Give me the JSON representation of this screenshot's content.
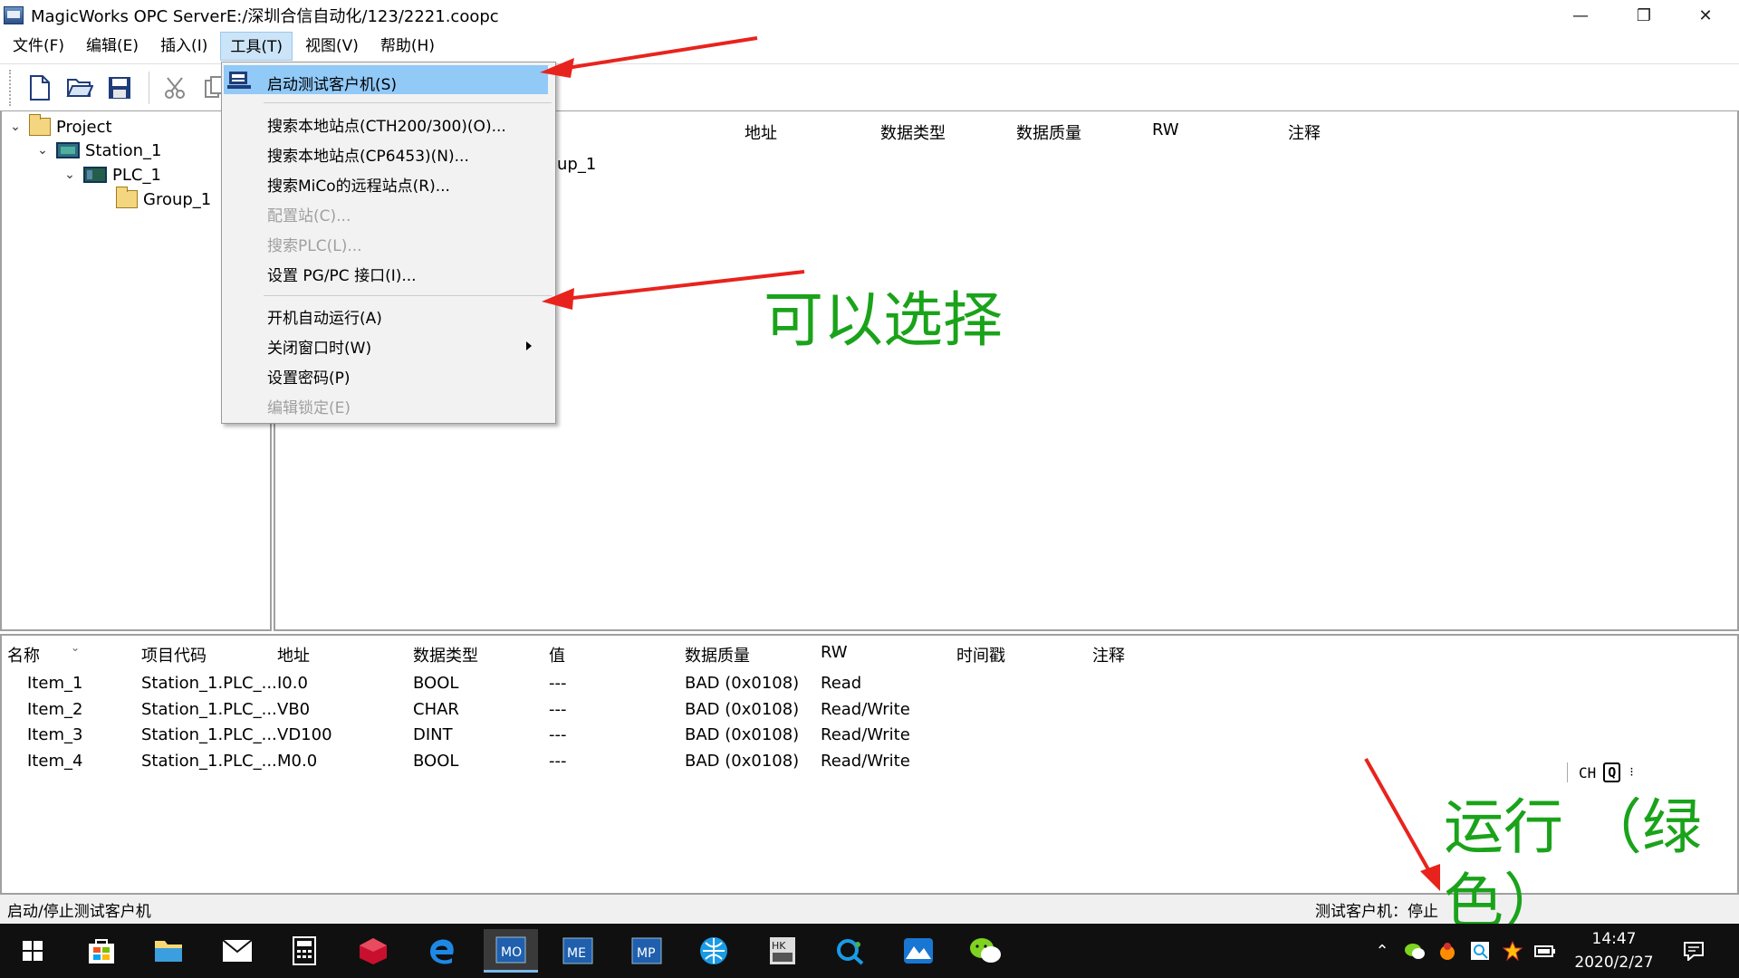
{
  "window": {
    "title": "MagicWorks OPC ServerE:/深圳合信自动化/123/2221.coopc",
    "minimize": "—",
    "maximize": "❐",
    "close": "✕"
  },
  "menubar": {
    "items": [
      "文件(F)",
      "编辑(E)",
      "插入(I)",
      "工具(T)",
      "视图(V)",
      "帮助(H)"
    ],
    "active": "工具(T)"
  },
  "toolbar": {
    "buttons": [
      "new-file-icon",
      "open-folder-icon",
      "save-icon",
      "cut-icon",
      "copy-icon"
    ]
  },
  "tree": {
    "project": "Project",
    "station": "Station_1",
    "plc": "PLC_1",
    "group": "Group_1"
  },
  "group_pane": {
    "columns": [
      "地址",
      "数据类型",
      "数据质量",
      "RW",
      "注释"
    ],
    "row_text": "oup_1"
  },
  "tools_menu": {
    "items": [
      {
        "label": "启动测试客户机(S)",
        "enabled": true,
        "highlighted": true
      },
      {
        "label": "搜索本地站点(CTH200/300)(O)...",
        "enabled": true
      },
      {
        "label": "搜索本地站点(CP6453)(N)...",
        "enabled": true
      },
      {
        "label": "搜索MiCo的远程站点(R)...",
        "enabled": true
      },
      {
        "label": "配置站(C)...",
        "enabled": false
      },
      {
        "label": "搜索PLC(L)...",
        "enabled": false
      },
      {
        "label": "设置 PG/PC 接口(I)...",
        "enabled": true
      },
      {
        "label": "开机自动运行(A)",
        "enabled": true
      },
      {
        "label": "关闭窗口时(W)",
        "enabled": true,
        "submenu": true
      },
      {
        "label": "设置密码(P)",
        "enabled": true
      },
      {
        "label": "编辑锁定(E)",
        "enabled": false
      }
    ]
  },
  "items_table": {
    "columns": [
      "名称",
      "项目代码",
      "地址",
      "数据类型",
      "值",
      "数据质量",
      "RW",
      "时间戳",
      "注释"
    ],
    "rows": [
      [
        "Item_1",
        "Station_1.PLC_...",
        "I0.0",
        "BOOL",
        "---",
        "BAD (0x0108)",
        "Read"
      ],
      [
        "Item_2",
        "Station_1.PLC_...",
        "VB0",
        "CHAR",
        "---",
        "BAD (0x0108)",
        "Read/Write"
      ],
      [
        "Item_3",
        "Station_1.PLC_...",
        "VD100",
        "DINT",
        "---",
        "BAD (0x0108)",
        "Read/Write"
      ],
      [
        "Item_4",
        "Station_1.PLC_...",
        "M0.0",
        "BOOL",
        "---",
        "BAD (0x0108)",
        "Read/Write"
      ]
    ]
  },
  "statusbar": {
    "left": "启动/停止测试客户机",
    "right": "测试客户机：停止"
  },
  "annotations": {
    "choose": "可以选择",
    "run_line1": "运行 （绿",
    "run_line2": "色）",
    "color": "#1aa31a",
    "arrow_color": "#e8231d"
  },
  "ime": {
    "lang": "CH"
  },
  "taskbar": {
    "time": "14:47",
    "date": "2020/2/27"
  }
}
